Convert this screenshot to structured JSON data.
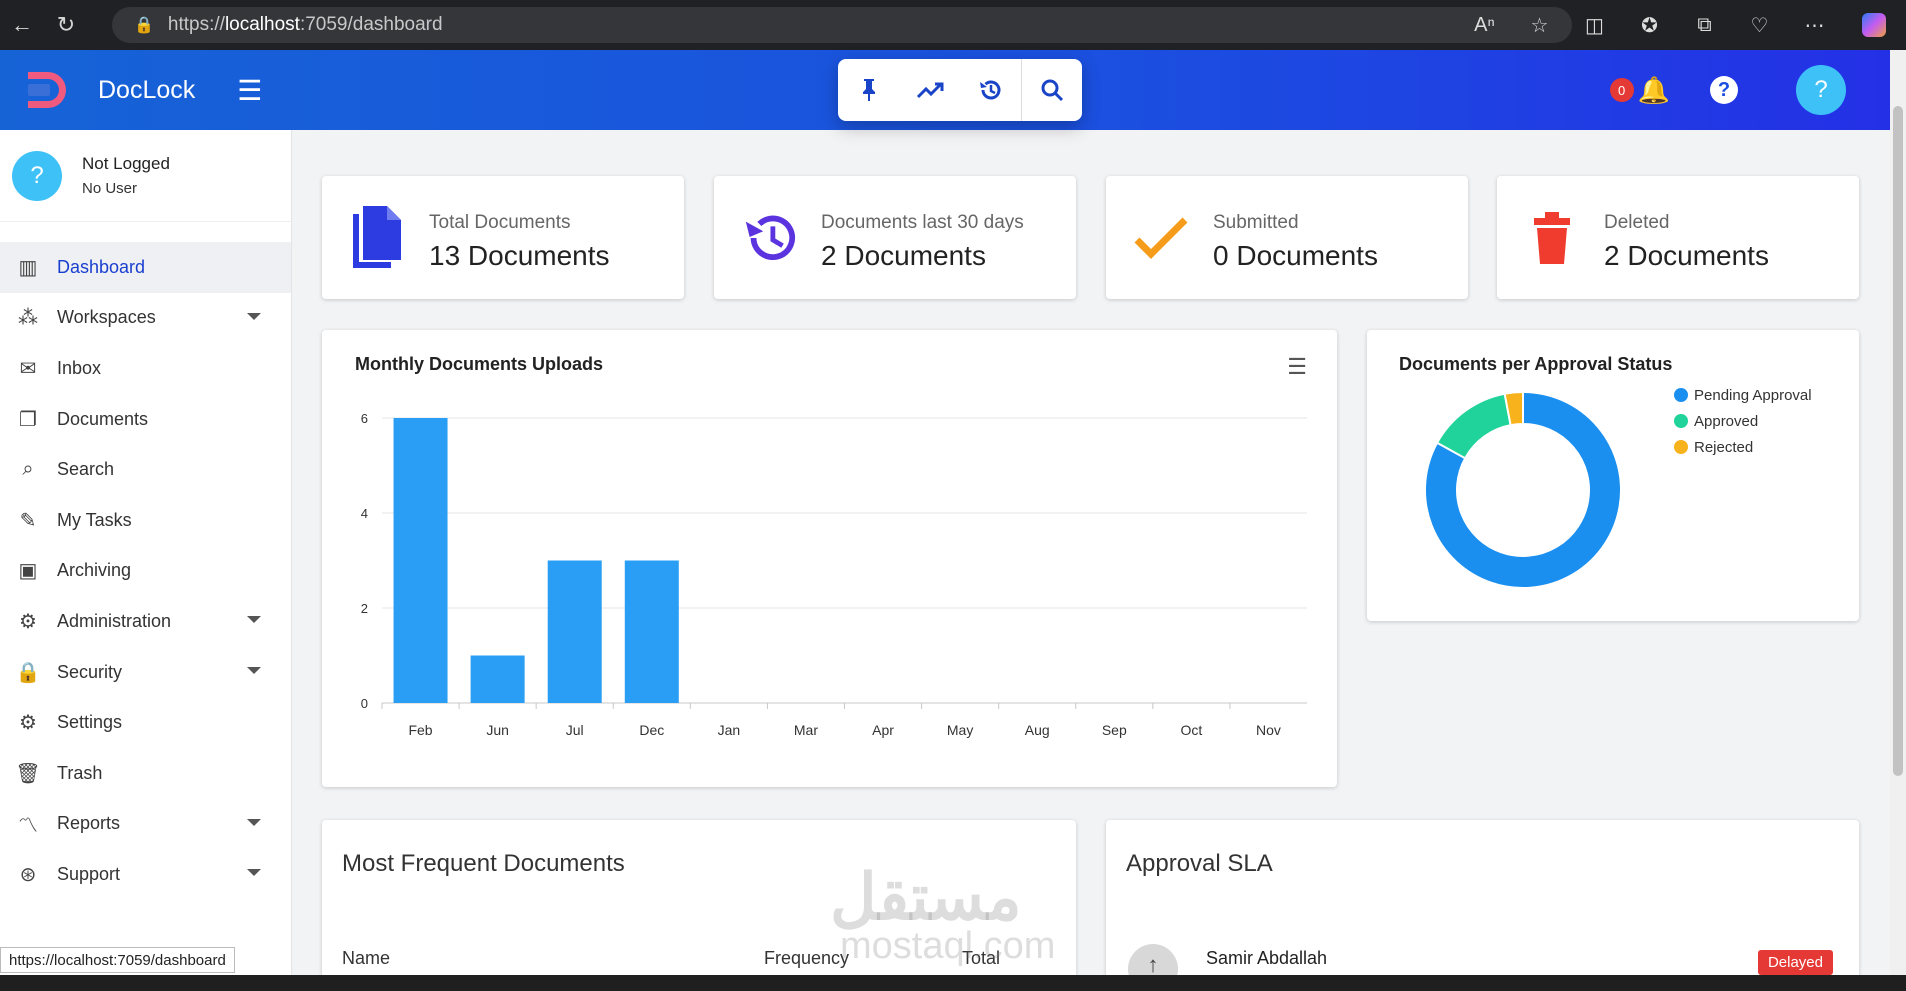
{
  "browser": {
    "url_prefix": "https://",
    "url_host": "localhost",
    "url_rest": ":7059/dashboard",
    "status_url": "https://localhost:7059/dashboard"
  },
  "app": {
    "brand": "DocLock",
    "notification_count": "0",
    "help_glyph": "?",
    "avatar_glyph": "?"
  },
  "user": {
    "name": "Not Logged",
    "sub": "No User"
  },
  "sidebar": {
    "items": [
      {
        "label": "Dashboard",
        "icon": "dashboard-icon",
        "glyph": "▥"
      },
      {
        "label": "Workspaces",
        "icon": "workspaces-icon",
        "glyph": "⁂"
      },
      {
        "label": "Inbox",
        "icon": "mail-icon",
        "glyph": "✉"
      },
      {
        "label": "Documents",
        "icon": "documents-icon",
        "glyph": "❐"
      },
      {
        "label": "Search",
        "icon": "search-icon",
        "glyph": "⌕"
      },
      {
        "label": "My Tasks",
        "icon": "task-icon",
        "glyph": "✎"
      },
      {
        "label": "Archiving",
        "icon": "archive-icon",
        "glyph": "▣"
      },
      {
        "label": "Administration",
        "icon": "admin-icon",
        "glyph": "⚙"
      },
      {
        "label": "Security",
        "icon": "lock-icon",
        "glyph": "🔒"
      },
      {
        "label": "Settings",
        "icon": "gear-icon",
        "glyph": "⚙"
      },
      {
        "label": "Trash",
        "icon": "trash-icon",
        "glyph": "🗑"
      },
      {
        "label": "Reports",
        "icon": "trend-icon",
        "glyph": "〽"
      },
      {
        "label": "Support",
        "icon": "support-icon",
        "glyph": "⊛"
      }
    ]
  },
  "stats": [
    {
      "label": "Total Documents",
      "value": "13 Documents",
      "color": "#2c3ce0"
    },
    {
      "label": "Documents last 30 days",
      "value": "2 Documents",
      "color": "#5b34e0"
    },
    {
      "label": "Submitted",
      "value": "0 Documents",
      "color": "#f59c1a"
    },
    {
      "label": "Deleted",
      "value": "2 Documents",
      "color": "#f03c2e"
    }
  ],
  "bar_chart": {
    "title": "Monthly Documents Uploads"
  },
  "donut_chart": {
    "title": "Documents per Approval Status"
  },
  "chart_data": [
    {
      "type": "bar",
      "title": "Monthly Documents Uploads",
      "categories": [
        "Feb",
        "Jun",
        "Jul",
        "Dec",
        "Jan",
        "Mar",
        "Apr",
        "May",
        "Aug",
        "Sep",
        "Oct",
        "Nov"
      ],
      "values": [
        6,
        1,
        3,
        3,
        0,
        0,
        0,
        0,
        0,
        0,
        0,
        0
      ],
      "ylim": [
        0,
        6
      ],
      "yticks": [
        0,
        2,
        4,
        6
      ],
      "color": "#2a9df4",
      "grid": true
    },
    {
      "type": "pie",
      "title": "Documents per Approval Status",
      "labels": [
        "Pending Approval",
        "Approved",
        "Rejected"
      ],
      "values": [
        83,
        14,
        3
      ],
      "colors": [
        "#1a8ff0",
        "#1fd39a",
        "#f7b21c"
      ],
      "legend": "top-right"
    }
  ],
  "frequent": {
    "title": "Most Frequent Documents",
    "col_name": "Name",
    "col_frequency": "Frequency",
    "col_total": "Total"
  },
  "sla": {
    "title": "Approval SLA",
    "person": "Samir Abdallah",
    "badge": "Delayed"
  },
  "watermark": {
    "arabic": "مستقل",
    "latin": "mostaql.com"
  }
}
